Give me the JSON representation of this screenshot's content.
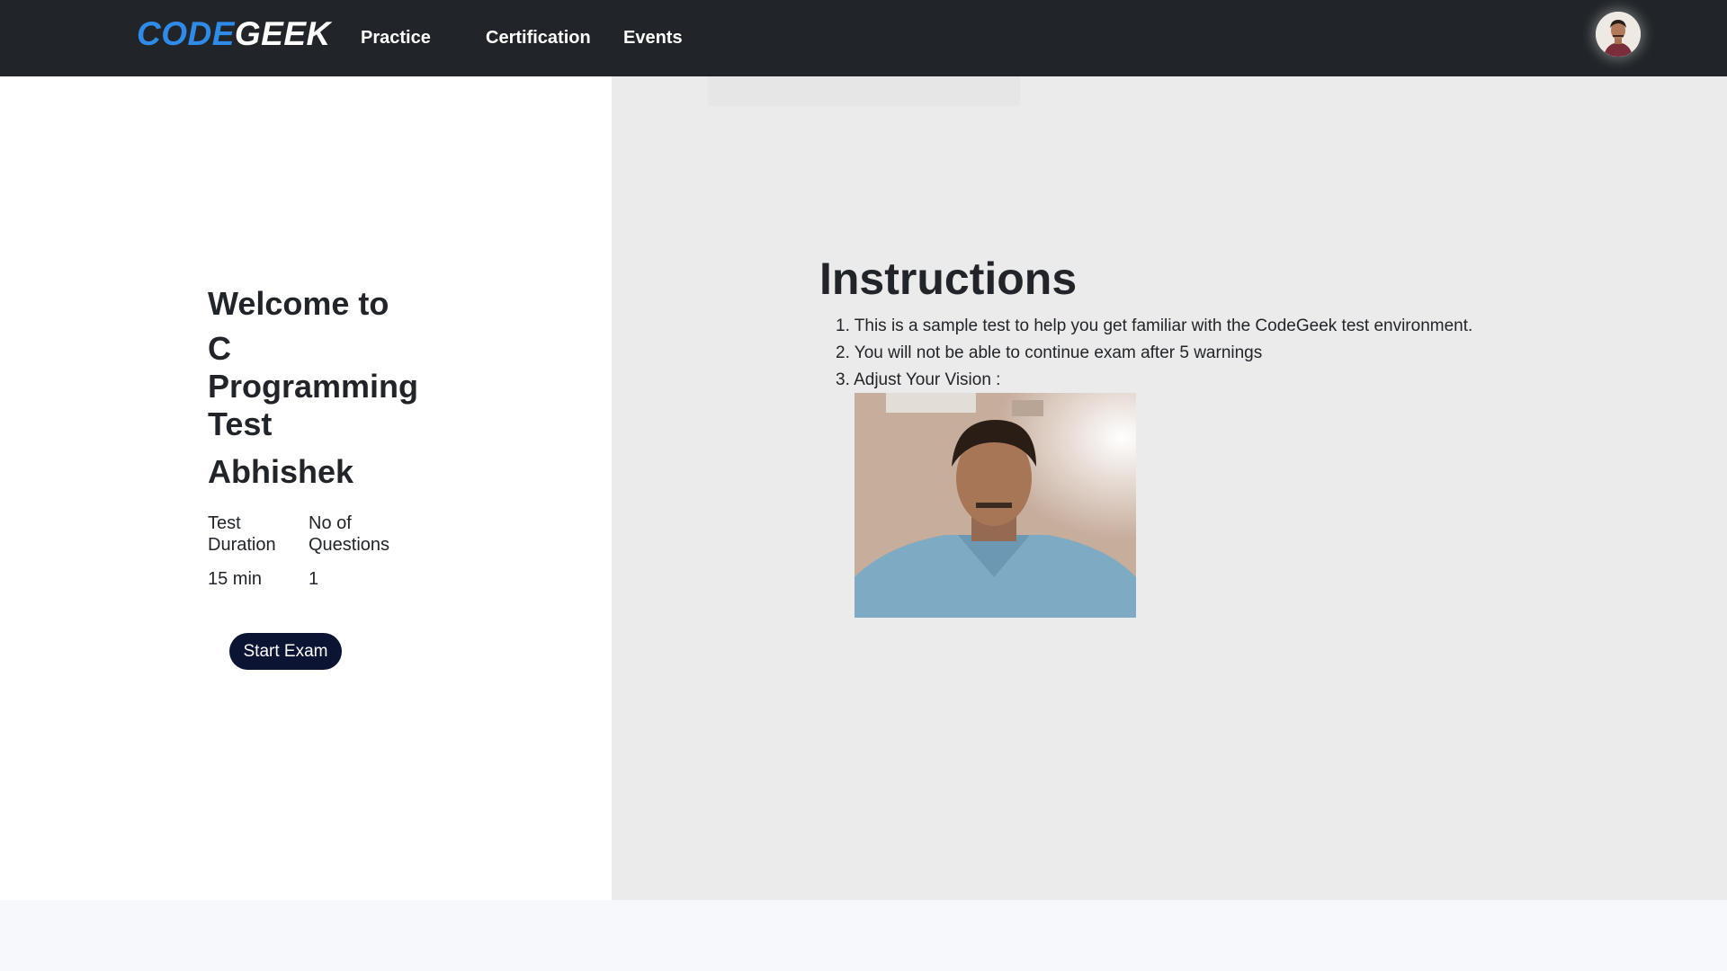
{
  "header": {
    "brand_part1": "CODE",
    "brand_part2": "GEEK",
    "nav": [
      {
        "label": "Practice"
      },
      {
        "label": "Certification"
      },
      {
        "label": "Events"
      }
    ],
    "profile_icon": "user-avatar"
  },
  "left": {
    "welcome": "Welcome to",
    "test_name": "C Programming Test",
    "user_name": "Abhishek",
    "duration_label": "Test Duration",
    "questions_label": "No of Questions",
    "duration_value": "15 min",
    "questions_value": "1",
    "start_button": "Start Exam"
  },
  "instructions": {
    "title": "Instructions",
    "items": [
      "1. This is a sample test to help you get familiar with the CodeGeek test environment.",
      "2. You will not be able to continue exam after 5 warnings",
      "3. Adjust Your Vision :"
    ],
    "webcam_icon": "webcam-feed"
  },
  "colors": {
    "navbar_bg": "#212529",
    "brand_accent": "#2f8ae8",
    "button_bg": "#0b1533",
    "right_panel_bg": "#ebebeb"
  }
}
